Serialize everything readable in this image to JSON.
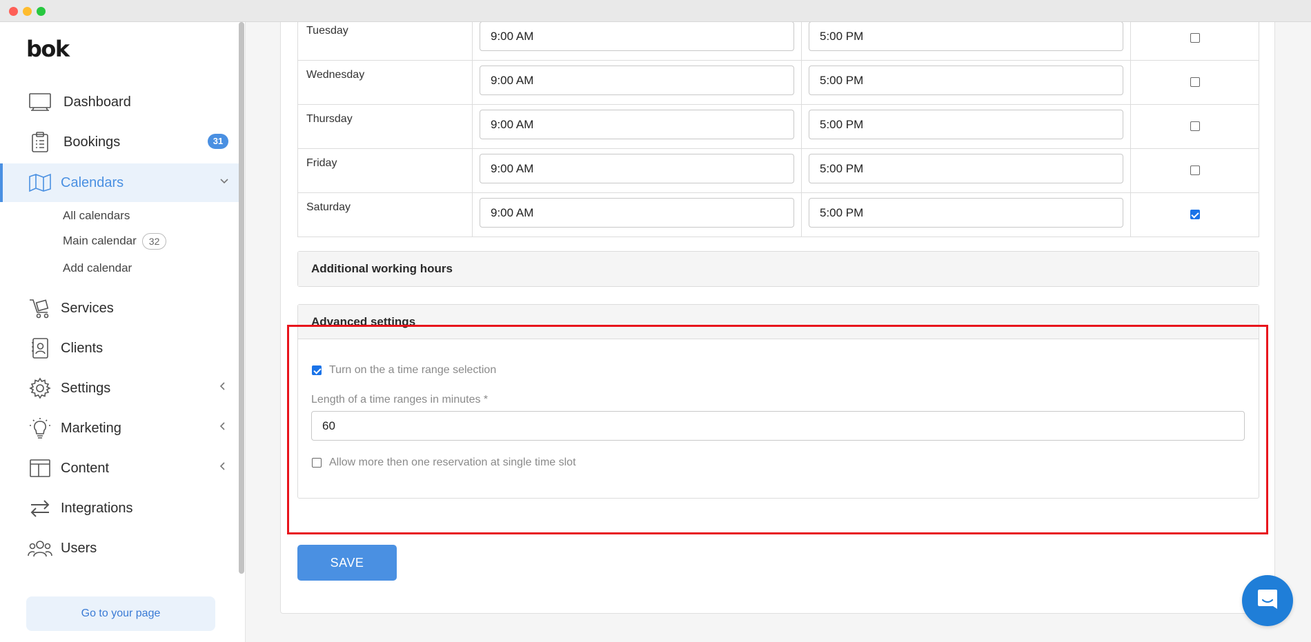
{
  "app": {
    "logo": "bok"
  },
  "sidebar": {
    "items": [
      {
        "label": "Dashboard",
        "icon": "dashboard-icon"
      },
      {
        "label": "Bookings",
        "icon": "clipboard-icon",
        "badge": "31"
      },
      {
        "label": "Calendars",
        "icon": "map-icon",
        "active": true
      },
      {
        "label": "Services",
        "icon": "cart-icon"
      },
      {
        "label": "Clients",
        "icon": "contact-icon"
      },
      {
        "label": "Settings",
        "icon": "gear-icon"
      },
      {
        "label": "Marketing",
        "icon": "lightbulb-icon"
      },
      {
        "label": "Content",
        "icon": "layout-icon"
      },
      {
        "label": "Integrations",
        "icon": "arrows-icon"
      },
      {
        "label": "Users",
        "icon": "users-icon"
      }
    ],
    "subitems": [
      {
        "label": "All calendars"
      },
      {
        "label": "Main calendar",
        "badge": "32"
      },
      {
        "label": "Add calendar"
      }
    ],
    "go_page": "Go to your page"
  },
  "hours": {
    "rows": [
      {
        "day": "Tuesday",
        "start": "9:00 AM",
        "end": "5:00 PM",
        "checked": false
      },
      {
        "day": "Wednesday",
        "start": "9:00 AM",
        "end": "5:00 PM",
        "checked": false
      },
      {
        "day": "Thursday",
        "start": "9:00 AM",
        "end": "5:00 PM",
        "checked": false
      },
      {
        "day": "Friday",
        "start": "9:00 AM",
        "end": "5:00 PM",
        "checked": false
      },
      {
        "day": "Saturday",
        "start": "9:00 AM",
        "end": "5:00 PM",
        "checked": true
      }
    ]
  },
  "additional": {
    "title": "Additional working hours"
  },
  "advanced": {
    "title": "Advanced settings",
    "time_range_label": "Turn on the a time range selection",
    "time_range_checked": true,
    "length_label": "Length of a time ranges in minutes *",
    "length_value": "60",
    "multi_label": "Allow more then one reservation at single time slot",
    "multi_checked": false
  },
  "save_label": "SAVE",
  "colors": {
    "accent": "#4a90e2",
    "highlight": "#e8141c"
  }
}
